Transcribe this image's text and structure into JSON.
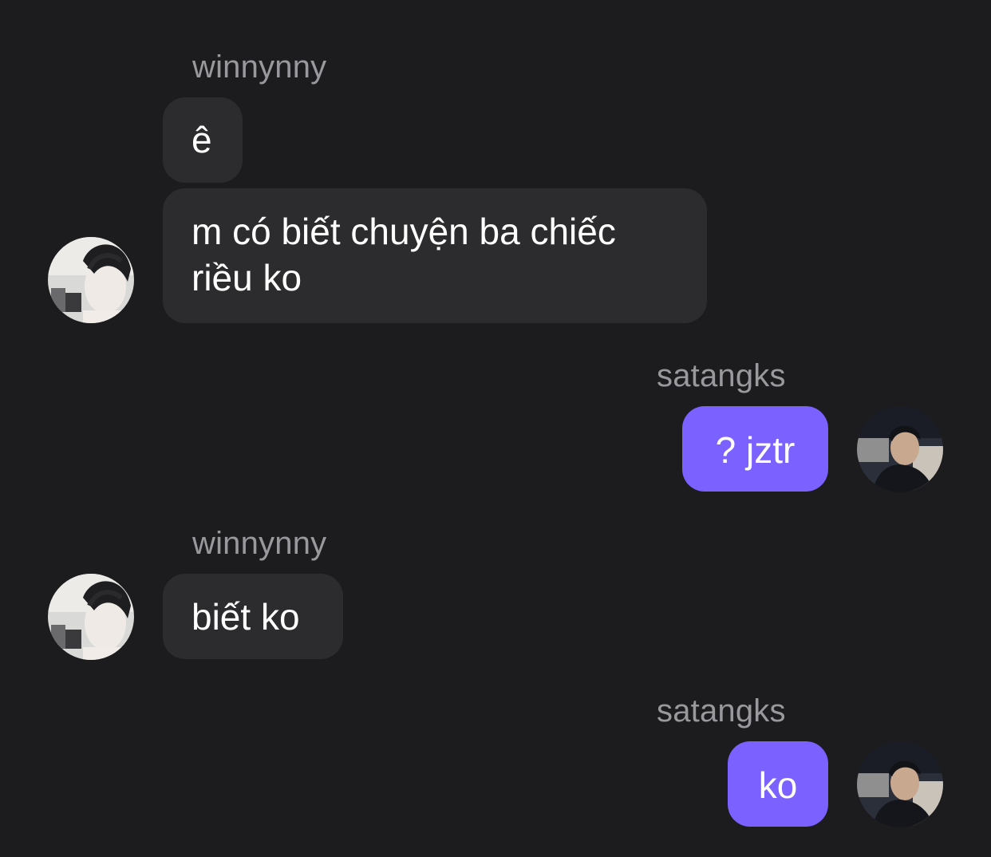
{
  "colors": {
    "background": "#1c1c1e",
    "incoming_bubble": "#2c2c2e",
    "outgoing_bubble": "#7b61ff",
    "sender_name": "#98989d",
    "message_text": "#ffffff"
  },
  "messages": [
    {
      "group": "incoming",
      "sender": "winnynny",
      "avatar_icon": "user-avatar-winnynny",
      "bubbles": [
        {
          "lines": [
            "ê"
          ]
        },
        {
          "lines": [
            "m có biết chuyện ba chiếc",
            "riều ko"
          ]
        }
      ]
    },
    {
      "group": "outgoing",
      "sender": "satangks",
      "avatar_icon": "user-avatar-satangks",
      "bubbles": [
        {
          "lines": [
            "? jztr"
          ]
        }
      ]
    },
    {
      "group": "incoming",
      "sender": "winnynny",
      "avatar_icon": "user-avatar-winnynny",
      "bubbles": [
        {
          "lines": [
            "biết ko"
          ]
        }
      ]
    },
    {
      "group": "outgoing",
      "sender": "satangks",
      "avatar_icon": "user-avatar-satangks",
      "bubbles": [
        {
          "lines": [
            "ko"
          ]
        }
      ]
    }
  ]
}
